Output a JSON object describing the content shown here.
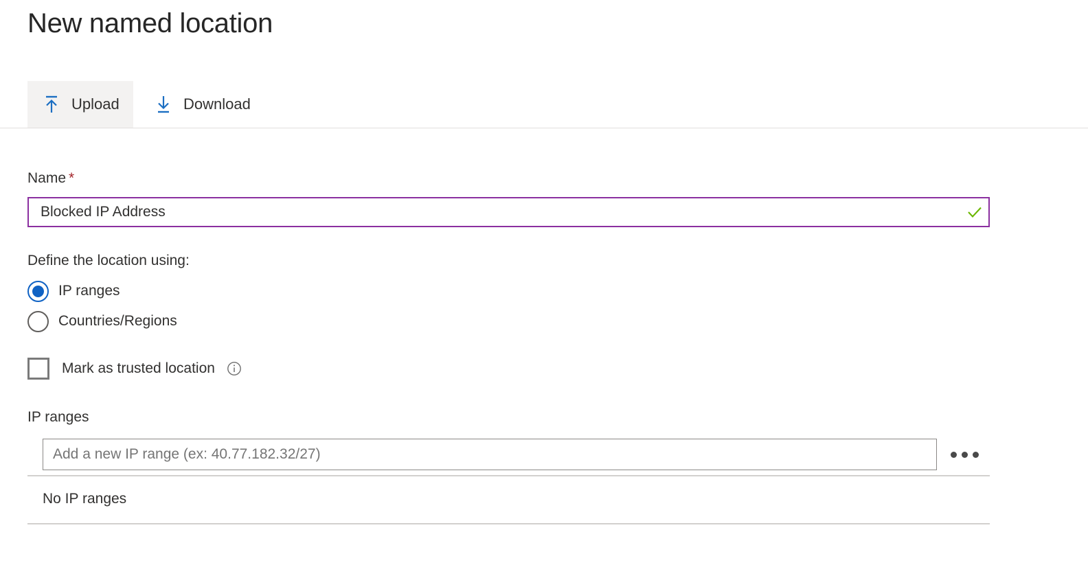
{
  "page": {
    "title": "New named location"
  },
  "toolbar": {
    "upload": {
      "label": "Upload",
      "icon": "upload-icon",
      "active": true
    },
    "download": {
      "label": "Download",
      "icon": "download-icon",
      "active": false
    },
    "icon_color": "#1b6ec2"
  },
  "form": {
    "name": {
      "label": "Name",
      "required_marker": "*",
      "value": "Blocked IP Address",
      "placeholder": "",
      "validation_icon": "checkmark-icon",
      "validation_color": "#6bb700",
      "focus_border_color": "#8b2fa0"
    },
    "define_using": {
      "label": "Define the location using:",
      "selected": "IP ranges",
      "accent_color": "#0f62c4",
      "options": [
        {
          "label": "IP ranges",
          "checked": true
        },
        {
          "label": "Countries/Regions",
          "checked": false
        }
      ]
    },
    "trusted": {
      "label": "Mark as trusted location",
      "checked": false,
      "info_icon": "info-icon"
    },
    "ip_ranges": {
      "label": "IP ranges",
      "input_value": "",
      "input_placeholder": "Add a new IP range (ex: 40.77.182.32/27)",
      "more_menu_icon": "ellipsis-icon",
      "empty_text": "No IP ranges"
    }
  }
}
